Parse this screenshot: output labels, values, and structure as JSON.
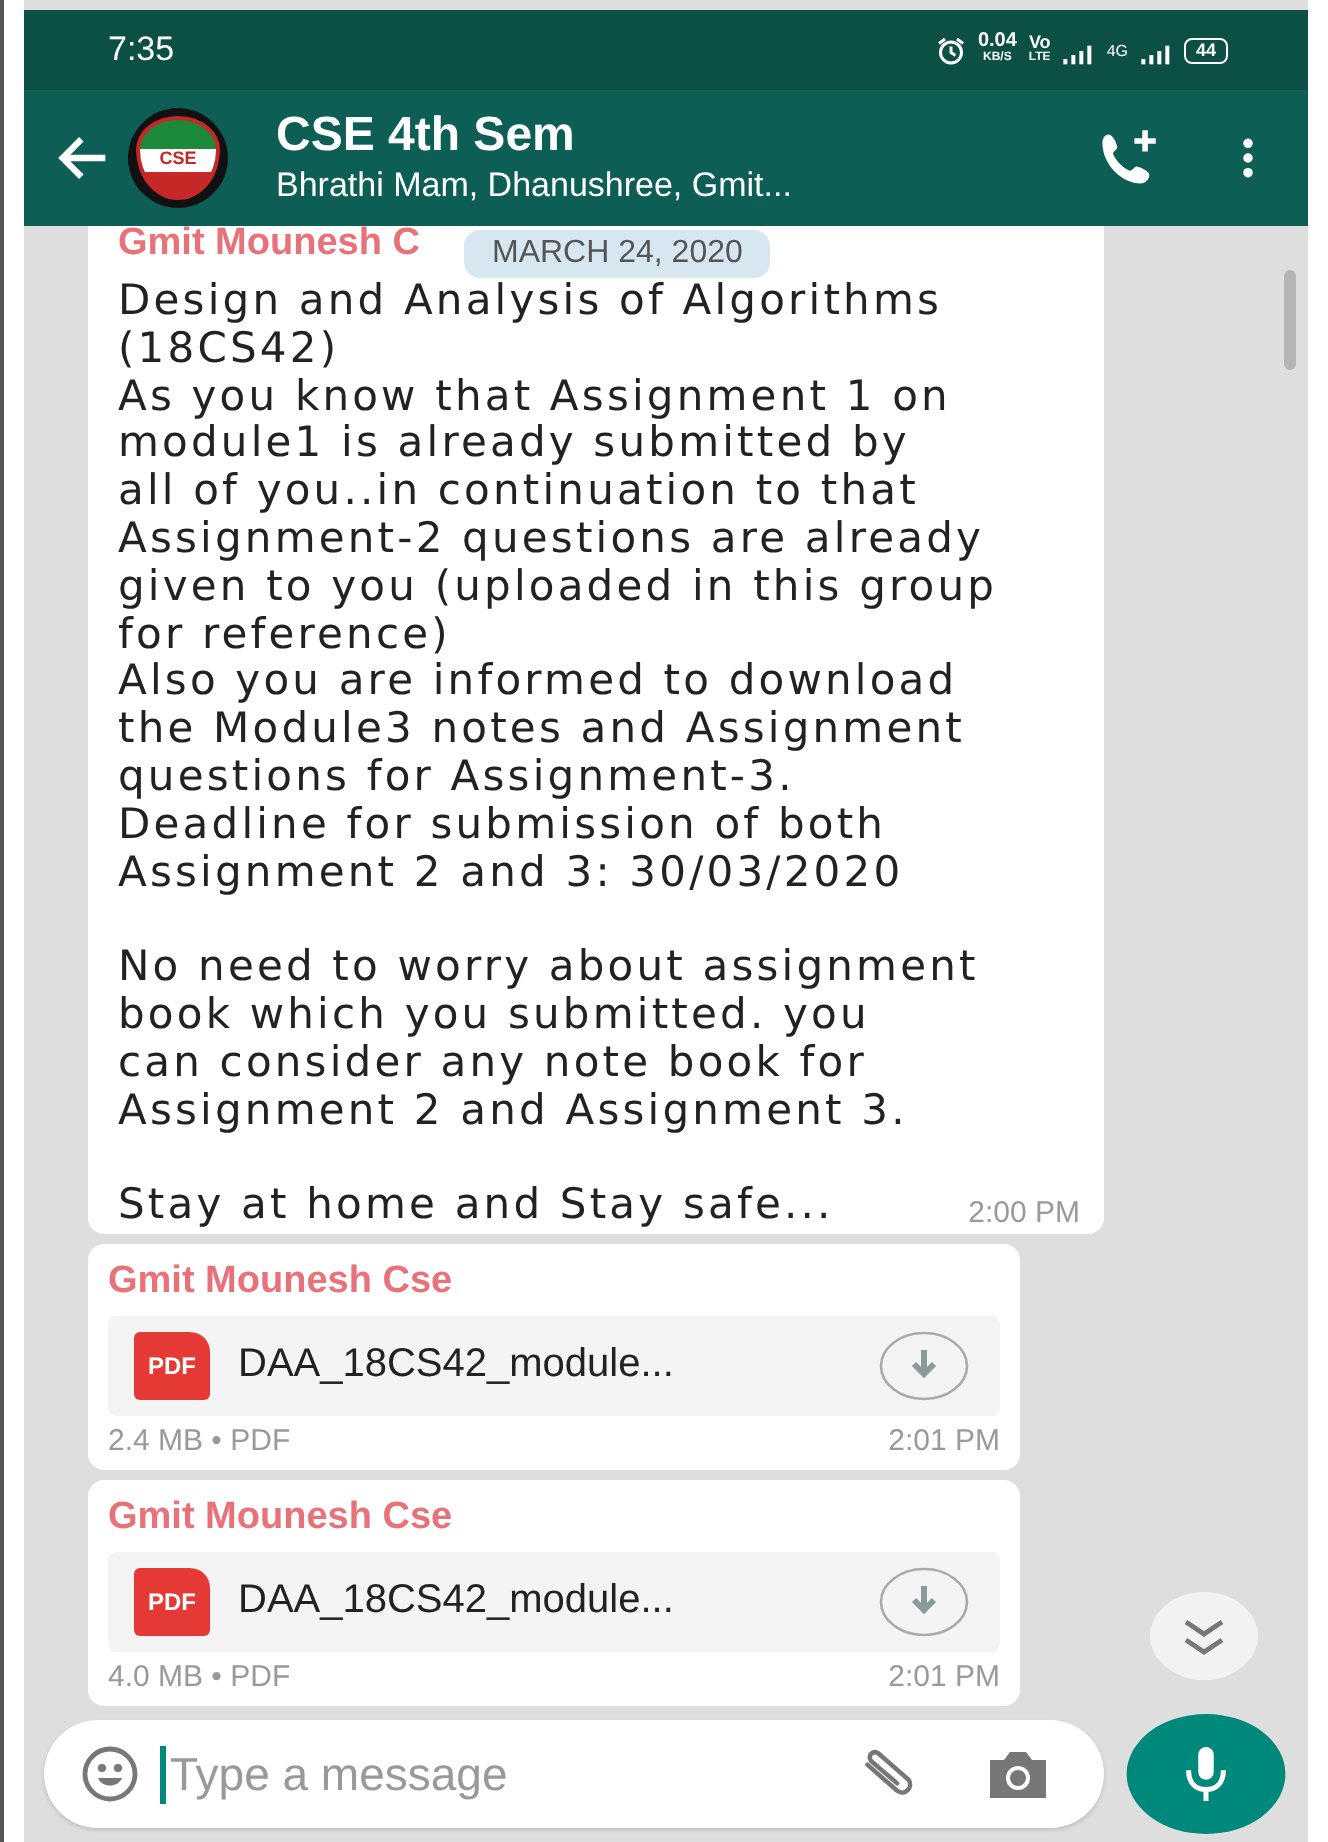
{
  "status_bar": {
    "time": "7:35",
    "speed": "0.04",
    "speed_unit": "KB/S",
    "volte_top": "Vo",
    "volte_bottom": "LTE",
    "network": "4G",
    "battery": "44"
  },
  "header": {
    "title": "CSE 4th Sem",
    "subtitle": "Bhrathi Mam, Dhanushree, Gmit...",
    "avatar_text": "CSE"
  },
  "date_chip": "MARCH 24, 2020",
  "messages": [
    {
      "kind": "text",
      "sender": "Gmit Mounesh C",
      "paragraphs": [
        "Design and Analysis of Algorithms\n(18CS42)\nAs you know that Assignment 1 on\nmodule1 is already submitted by\nall of you..in continuation to that\nAssignment-2 questions are already\ngiven to you (uploaded in this group\nfor reference)\nAlso you are informed to download\nthe Module3 notes and Assignment\nquestions for Assignment-3.\nDeadline for submission of both\nAssignment 2 and 3: 30/03/2020",
        "No need to worry about assignment\nbook which you submitted. you\ncan consider any note book for\nAssignment 2 and Assignment 3.",
        "Stay at home and Stay safe..."
      ],
      "time": "2:00 PM"
    },
    {
      "kind": "file",
      "sender": "Gmit Mounesh Cse",
      "file_badge": "PDF",
      "file_name": "DAA_18CS42_module...",
      "meta": "2.4 MB • PDF",
      "time": "2:01 PM"
    },
    {
      "kind": "file",
      "sender": "Gmit Mounesh Cse",
      "file_badge": "PDF",
      "file_name": "DAA_18CS42_module...",
      "meta": "4.0 MB • PDF",
      "time": "2:01 PM"
    }
  ],
  "composer": {
    "placeholder": "Type a message"
  }
}
